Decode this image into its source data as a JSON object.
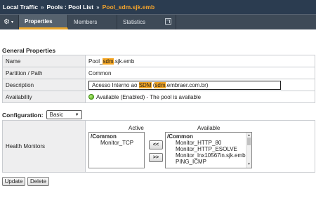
{
  "breadcrumb": {
    "root": "Local Traffic",
    "sep1": "»",
    "section": "Pools : Pool List",
    "sep2": "»",
    "current": "Pool_sdm.sjk.emb"
  },
  "tabs": {
    "menu_icon": "⚙",
    "menu_caret": "▾",
    "properties": "Properties",
    "members": "Members",
    "statistics": "Statistics"
  },
  "general": {
    "title": "General Properties",
    "name_label": "Name",
    "name_prefix": "Pool_",
    "name_highlight": "sdm",
    "name_suffix": ".sjk.emb",
    "partition_label": "Partition / Path",
    "partition_value": "Common",
    "description_label": "Description",
    "description_prefix": "Acesso Interno ao ",
    "description_hl1": "SDM",
    "description_mid": " (",
    "description_hl2": "sdm",
    "description_suffix": ".embraer.com.br)",
    "availability_label": "Availability",
    "availability_value": "Available (Enabled) - The pool is available",
    "status_color": "#4aa514"
  },
  "configuration": {
    "label": "Configuration:",
    "selected": "Basic"
  },
  "health_monitors": {
    "label": "Health Monitors",
    "active_header": "Active",
    "available_header": "Available",
    "active_group": "/Common",
    "active_items": [
      "Monitor_TCP"
    ],
    "available_group": "/Common",
    "available_items": [
      "Monitor_HTTP_80",
      "Monitor_HTTP_ESOLVE",
      "Monitor_lnx10567in.sjk.emb",
      "PING_ICMP"
    ],
    "add_label": "<<",
    "remove_label": ">>"
  },
  "actions": {
    "update": "Update",
    "delete": "Delete"
  },
  "colors": {
    "header_bg": "#2b3c50",
    "accent": "#f5a623"
  }
}
